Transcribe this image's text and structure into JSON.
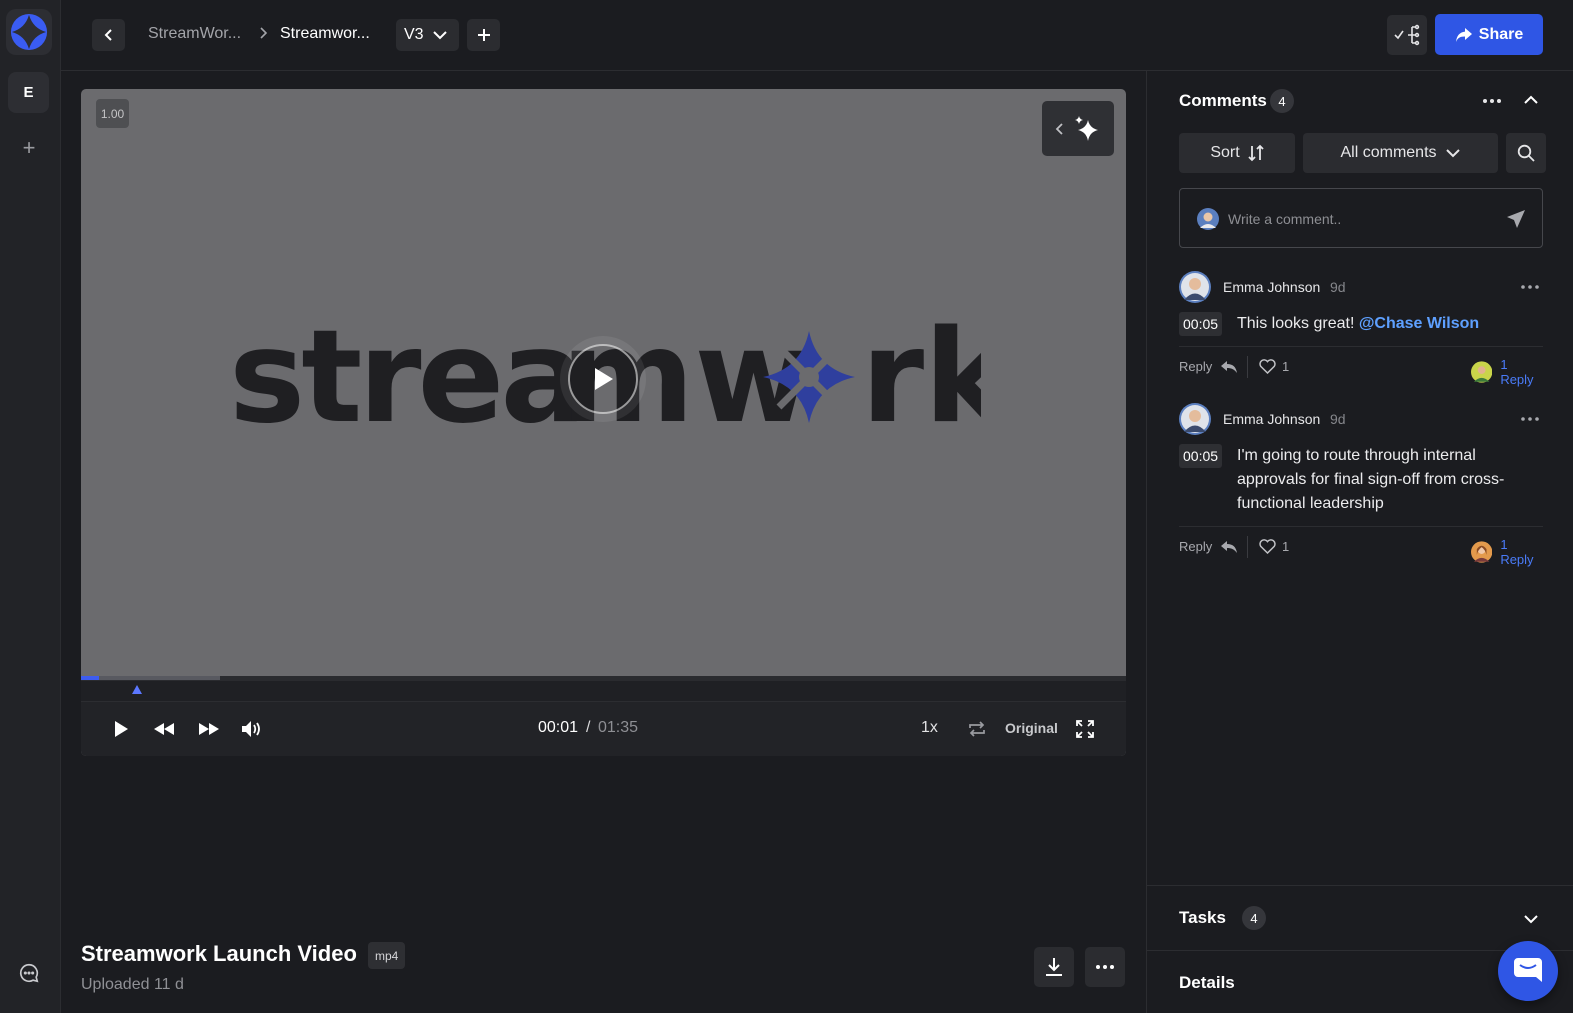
{
  "breadcrumb": {
    "parent": "StreamWor...",
    "current": "Streamwor...",
    "version": "V3"
  },
  "actions": {
    "share_label": "Share"
  },
  "workspace": {
    "initial": "E"
  },
  "player": {
    "zoom": "1.00",
    "current_time": "00:01",
    "separator": "/",
    "duration": "01:35",
    "speed": "1x",
    "quality": "Original",
    "progress_fraction": 0.017,
    "buffered_fraction": 0.133
  },
  "video": {
    "title": "Streamwork Launch Video",
    "format": "mp4",
    "uploaded": "Uploaded 11 d"
  },
  "comments": {
    "heading": "Comments",
    "count": "4",
    "sort_label": "Sort",
    "filter_label": "All comments",
    "placeholder": "Write a comment..",
    "items": [
      {
        "author": "Emma Johnson",
        "age": "9d",
        "timestamp": "00:05",
        "text": "This looks great! ",
        "mention": "@Chase Wilson",
        "reply_label": "Reply",
        "likes": "1",
        "replies": "1 Reply"
      },
      {
        "author": "Emma Johnson",
        "age": "9d",
        "timestamp": "00:05",
        "text": "I'm going to route through internal approvals for final sign-off from cross-functional leadership",
        "mention": "",
        "reply_label": "Reply",
        "likes": "1",
        "replies": "1 Reply"
      }
    ]
  },
  "tasks": {
    "heading": "Tasks",
    "count": "4"
  },
  "details": {
    "heading": "Details"
  },
  "colors": {
    "accent": "#2f56e5",
    "mention": "#5ea0ff",
    "background": "#1b1c20"
  }
}
